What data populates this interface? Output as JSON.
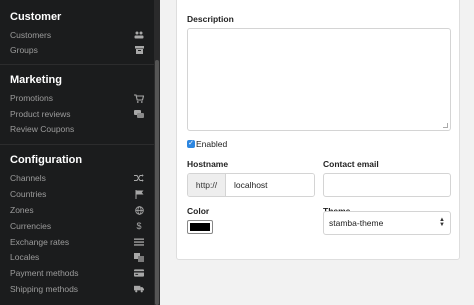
{
  "sidebar": {
    "sections": [
      {
        "title": "Customer",
        "items": [
          {
            "label": "Customers",
            "icon": "users-icon"
          },
          {
            "label": "Groups",
            "icon": "archive-icon"
          }
        ]
      },
      {
        "title": "Marketing",
        "items": [
          {
            "label": "Promotions",
            "icon": "cart-icon"
          },
          {
            "label": "Product reviews",
            "icon": "comments-icon"
          },
          {
            "label": "Review Coupons",
            "icon": ""
          }
        ]
      },
      {
        "title": "Configuration",
        "items": [
          {
            "label": "Channels",
            "icon": "random-icon"
          },
          {
            "label": "Countries",
            "icon": "flag-icon"
          },
          {
            "label": "Zones",
            "icon": "globe-icon"
          },
          {
            "label": "Currencies",
            "icon": "dollar-icon"
          },
          {
            "label": "Exchange rates",
            "icon": "list-icon"
          },
          {
            "label": "Locales",
            "icon": "translate-icon"
          },
          {
            "label": "Payment methods",
            "icon": "payment-icon"
          },
          {
            "label": "Shipping methods",
            "icon": "shipping-icon"
          }
        ]
      }
    ]
  },
  "form": {
    "description_label": "Description",
    "description_value": "",
    "enabled_label": "Enabled",
    "enabled_checked": true,
    "hostname_label": "Hostname",
    "hostname_prefix": "http://",
    "hostname_value": "localhost",
    "contact_email_label": "Contact email",
    "contact_email_value": "",
    "color_label": "Color",
    "color_value": "#000000",
    "theme_label": "Theme",
    "theme_selected": "stamba-theme"
  },
  "colors": {
    "sidebar_bg": "#1b1c1d",
    "checkbox_accent": "#2d86e0"
  }
}
